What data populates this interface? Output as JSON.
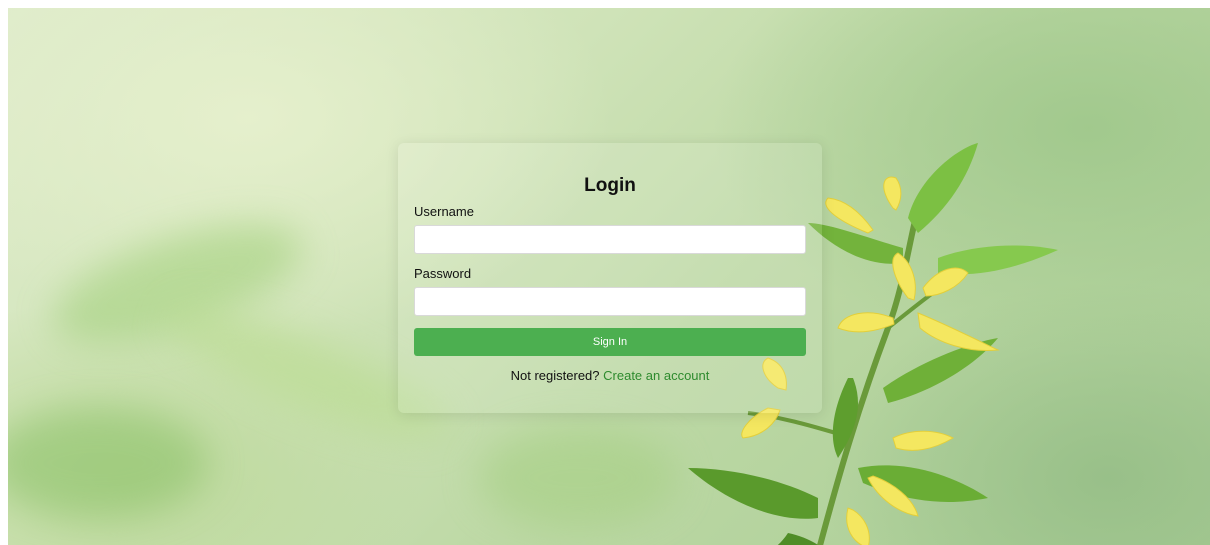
{
  "login": {
    "title": "Login",
    "username_label": "Username",
    "username_value": "",
    "password_label": "Password",
    "password_value": "",
    "signin_label": "Sign In",
    "register_prompt": "Not registered?",
    "register_link": "Create an account"
  },
  "colors": {
    "button": "#4caf50",
    "link": "#2e8b2e",
    "background": "#cfe3b8"
  },
  "icons": {
    "background": "yellow-flower-plant-image"
  }
}
